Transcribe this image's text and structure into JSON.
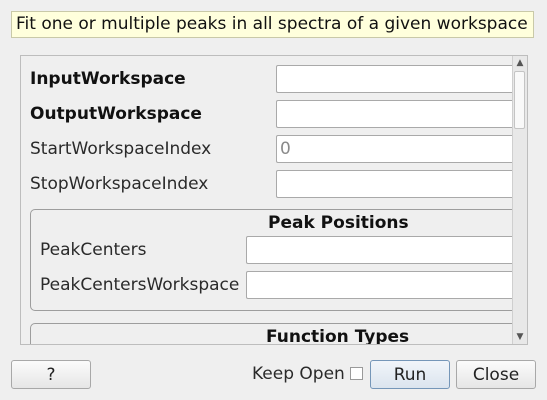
{
  "description": "Fit one or multiple peaks in all spectra of a given workspace",
  "properties": {
    "input_workspace": {
      "label": "InputWorkspace",
      "value": ""
    },
    "output_workspace": {
      "label": "OutputWorkspace",
      "value": ""
    },
    "start_workspace_index": {
      "label": "StartWorkspaceIndex",
      "value": "",
      "placeholder": "0"
    },
    "stop_workspace_index": {
      "label": "StopWorkspaceIndex",
      "value": ""
    }
  },
  "peak_positions": {
    "title": "Peak Positions",
    "peak_centers": {
      "label": "PeakCenters",
      "value": ""
    },
    "peak_centers_workspace": {
      "label": "PeakCentersWorkspace",
      "value": ""
    }
  },
  "function_types": {
    "title": "Function Types"
  },
  "scrollbar": {
    "up_icon": "▲",
    "down_icon": "▼"
  },
  "buttons": {
    "help": "?",
    "keep_open": "Keep Open",
    "keep_open_checked": false,
    "run": "Run",
    "close": "Close"
  }
}
